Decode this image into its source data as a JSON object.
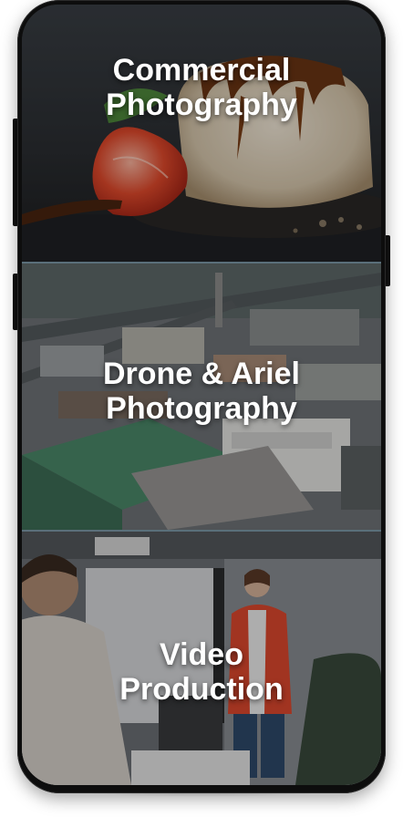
{
  "services": [
    {
      "title": "Commercial\nPhotography",
      "image": "dessert-photo"
    },
    {
      "title": "Drone & Ariel\nPhotography",
      "image": "aerial-industrial-photo"
    },
    {
      "title": "Video\nProduction",
      "image": "presentation-video-photo"
    }
  ],
  "colors": {
    "overlay": "#00000047",
    "divider": "#5a6f7a",
    "phone_body": "#0d0d0d"
  }
}
